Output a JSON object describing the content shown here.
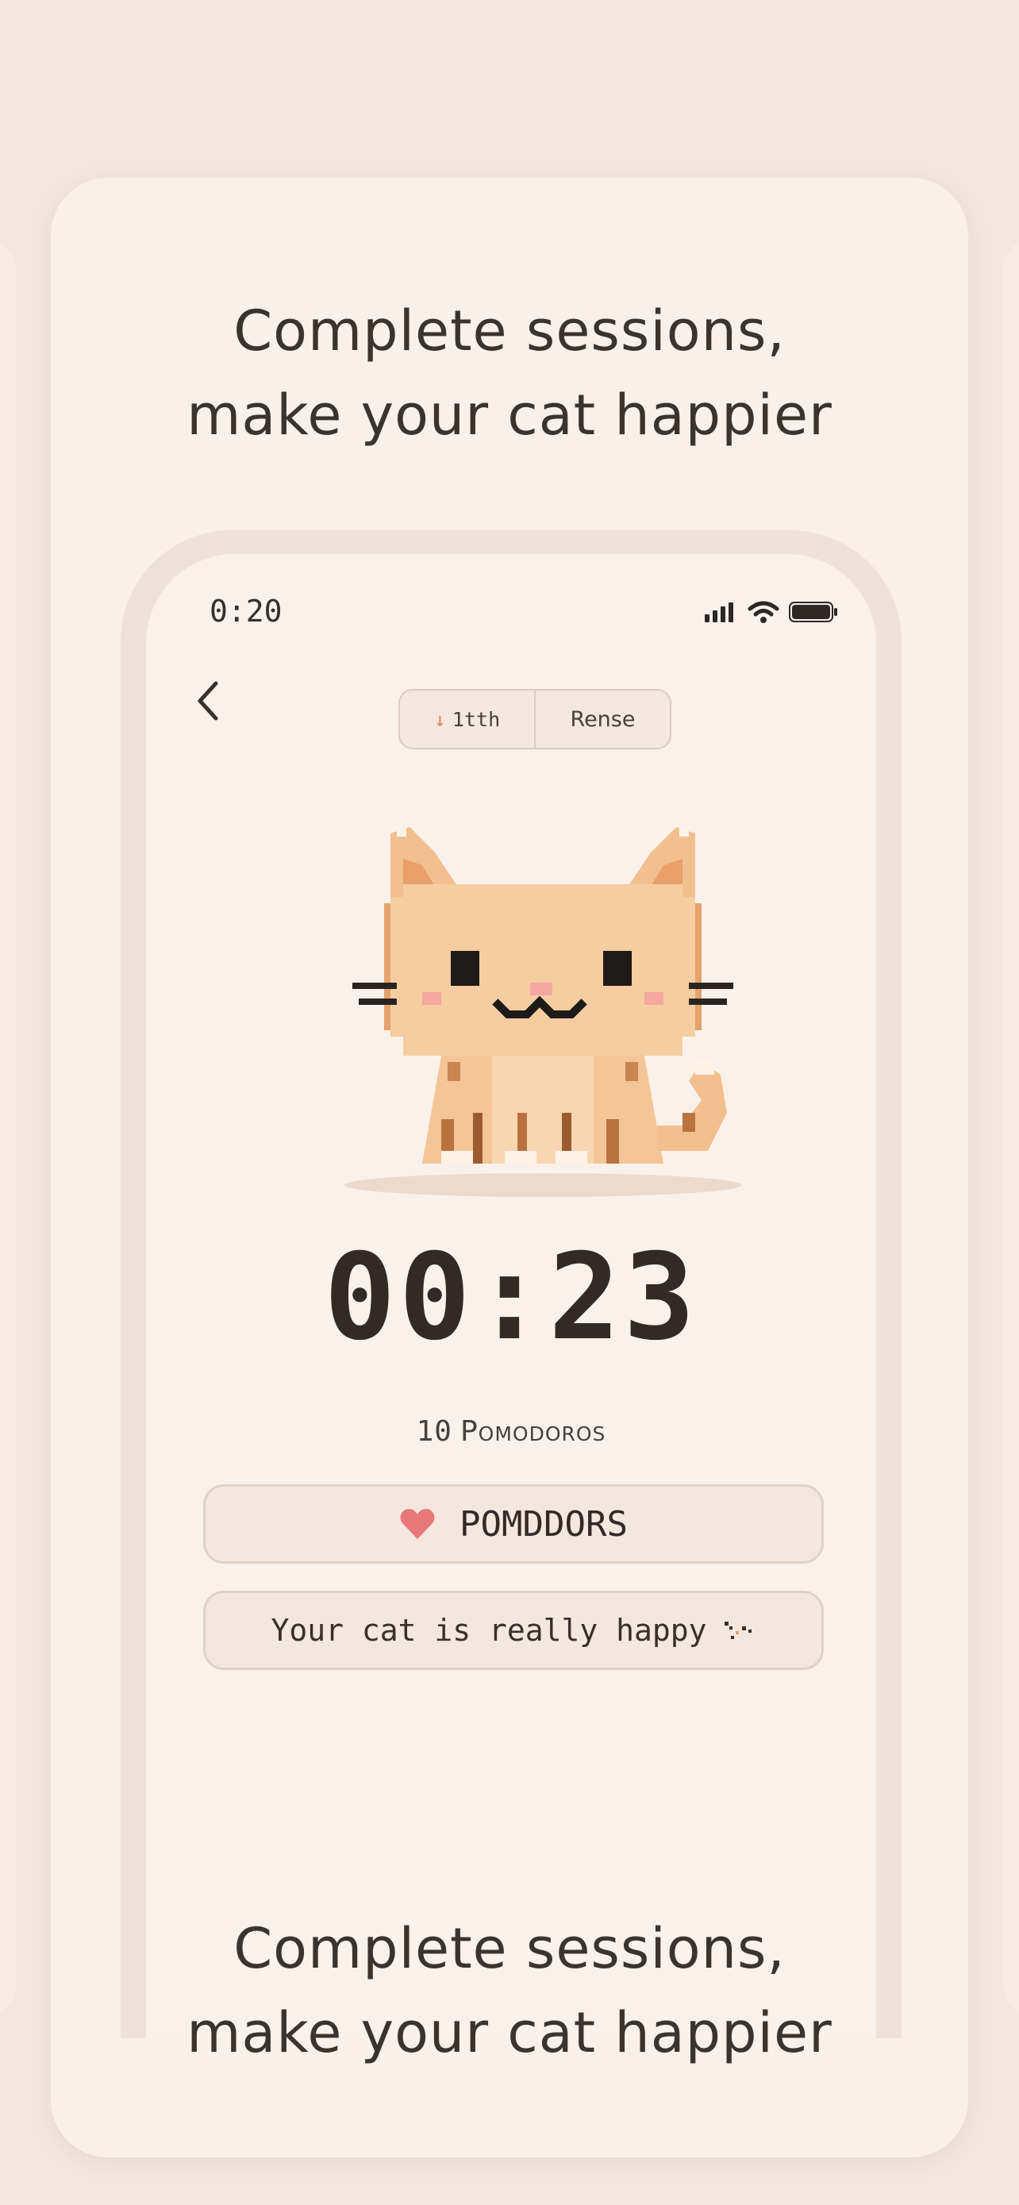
{
  "marketing": {
    "headline_top_line1": "Complete sessions,",
    "headline_top_line2": "make your cat happier",
    "headline_bottom_line1": "Complete sessions,",
    "headline_bottom_line2": "make your cat happier"
  },
  "status_bar": {
    "time": "0:20",
    "icons": [
      "signal-icon",
      "wifi-icon",
      "battery-icon"
    ]
  },
  "nav": {
    "back_icon": "chevron-left-icon"
  },
  "segmented": {
    "first_arrow": "↓",
    "first_label": "1tth",
    "second_label": "Rense"
  },
  "timer": {
    "display": "00:23"
  },
  "pomodoros": {
    "count": "10",
    "label": "Pomodoros"
  },
  "primary_button": {
    "icon": "heart-icon",
    "label": "POMDDORS"
  },
  "status_message": {
    "text": "Your cat is really happy",
    "icon": "sparkle-icon"
  },
  "colors": {
    "background": "#f3e8df",
    "card": "#f9f0e9",
    "screen": "#faf1ea",
    "accent_heart": "#e8787a",
    "cat_fur": "#f2c08f"
  }
}
